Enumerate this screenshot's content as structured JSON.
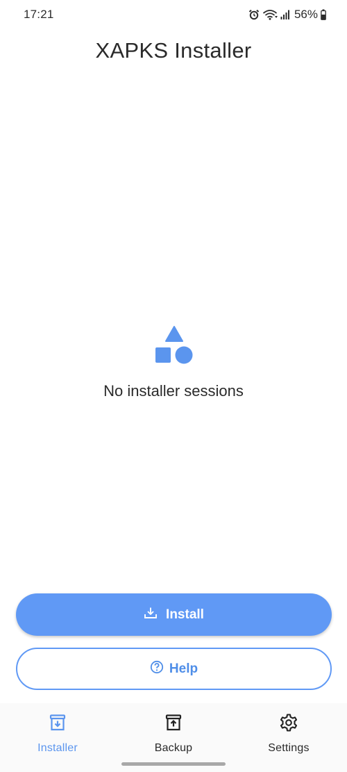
{
  "status_bar": {
    "time": "17:21",
    "battery": "56%",
    "icons": [
      "alarm-icon",
      "wifi-icon",
      "signal-icon",
      "battery-icon"
    ]
  },
  "app": {
    "title": "XAPKS Installer"
  },
  "empty_state": {
    "icon": "shapes-icon",
    "message": "No installer sessions"
  },
  "actions": {
    "install_label": "Install",
    "install_icon": "download-icon",
    "help_label": "Help",
    "help_icon": "help-circle-icon"
  },
  "bottom_nav": {
    "items": [
      {
        "label": "Installer",
        "icon": "installer-icon",
        "active": true
      },
      {
        "label": "Backup",
        "icon": "backup-icon",
        "active": false
      },
      {
        "label": "Settings",
        "icon": "gear-icon",
        "active": false
      }
    ]
  },
  "colors": {
    "accent": "#6099f5",
    "nav_active": "#5b95ee",
    "text": "#2a2a2a",
    "background": "#ffffff"
  }
}
